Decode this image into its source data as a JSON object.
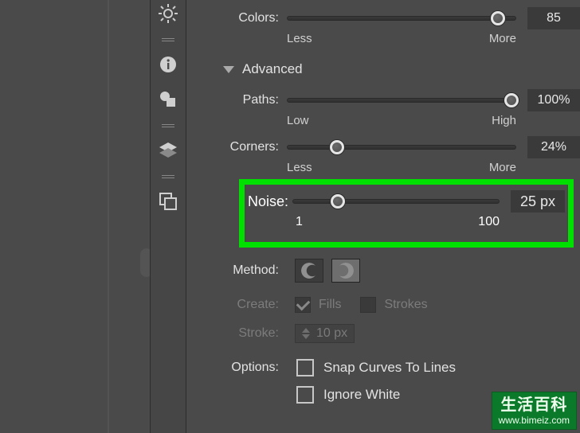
{
  "colors_row": {
    "label": "Colors:",
    "value": "85",
    "min_label": "Less",
    "max_label": "More",
    "thumb_pct": 92
  },
  "advanced_label": "Advanced",
  "paths_row": {
    "label": "Paths:",
    "value": "100%",
    "min_label": "Low",
    "max_label": "High",
    "thumb_pct": 98
  },
  "corners_row": {
    "label": "Corners:",
    "value": "24%",
    "min_label": "Less",
    "max_label": "More",
    "thumb_pct": 22
  },
  "noise_row": {
    "label": "Noise:",
    "value": "25 px",
    "min_label": "1",
    "max_label": "100",
    "thumb_pct": 22
  },
  "method_label": "Method:",
  "create": {
    "label": "Create:",
    "fills_label": "Fills",
    "fills_checked": true,
    "strokes_label": "Strokes",
    "strokes_checked": false
  },
  "stroke": {
    "label": "Stroke:",
    "value": "10 px"
  },
  "options": {
    "label": "Options:",
    "snap_label": "Snap Curves To Lines",
    "snap_checked": false,
    "ignore_label": "Ignore White",
    "ignore_checked": false
  },
  "watermark": {
    "line1": "生活百科",
    "line2": "www.bimeiz.com"
  }
}
